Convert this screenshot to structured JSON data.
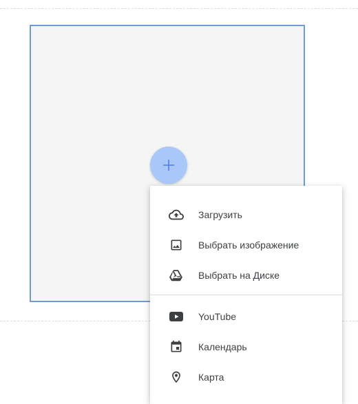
{
  "colors": {
    "placeholder_border": "#6f9ad3",
    "placeholder_fill": "#f5f5f5",
    "fab_fill": "#a9c7f9",
    "fab_plus": "#4a80e8",
    "icon_color": "#3c4043",
    "text_color": "#3c4043"
  },
  "fab": {
    "icon": "plus-icon"
  },
  "menu": {
    "upload_group": [
      {
        "icon": "cloud-upload-icon",
        "label": "Загрузить"
      },
      {
        "icon": "image-icon",
        "label": "Выбрать изображение"
      },
      {
        "icon": "drive-icon",
        "label": "Выбрать на Диске"
      }
    ],
    "embed_group": [
      {
        "icon": "youtube-icon",
        "label": "YouTube"
      },
      {
        "icon": "calendar-icon",
        "label": "Календарь"
      },
      {
        "icon": "map-pin-icon",
        "label": "Карта"
      }
    ]
  }
}
